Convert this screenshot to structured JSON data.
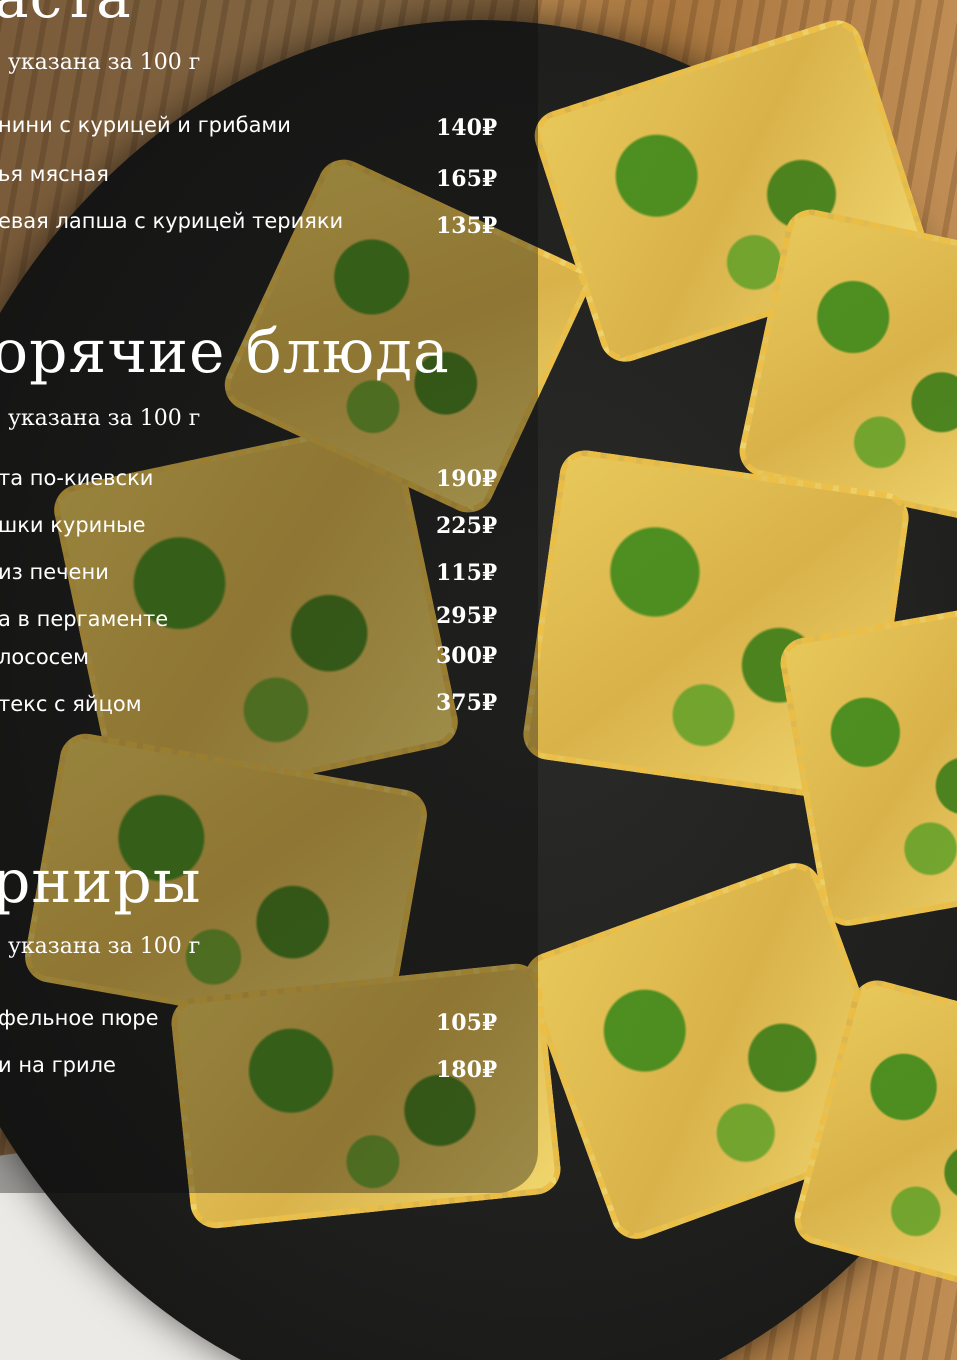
{
  "sections": [
    {
      "title": "аста",
      "note": ", указана за 100 г",
      "items": [
        {
          "name": "нини с курицей и грибами",
          "price": "140₽"
        },
        {
          "name": "ья мясная",
          "price": "165₽"
        },
        {
          "name": "евая лапша с курицей терияки",
          "price": "135₽"
        }
      ]
    },
    {
      "title": "орячие блюда",
      "note": ", указана за 100 г",
      "items": [
        {
          "name": "та по-киевски",
          "price": "190₽"
        },
        {
          "name": "шки куриные",
          "price": "225₽"
        },
        {
          "name": "из печени",
          "price": "115₽"
        },
        {
          "name": "а в пергаменте",
          "price": "295₽"
        },
        {
          "name": "лососем",
          "price": "300₽"
        },
        {
          "name": "текс с яйцом",
          "price": "375₽"
        }
      ]
    },
    {
      "title": "рниры",
      "note": ", указана за 100 г",
      "items": [
        {
          "name": "фельное пюре",
          "price": "105₽"
        },
        {
          "name": "и на гриле",
          "price": "180₽"
        }
      ]
    }
  ]
}
